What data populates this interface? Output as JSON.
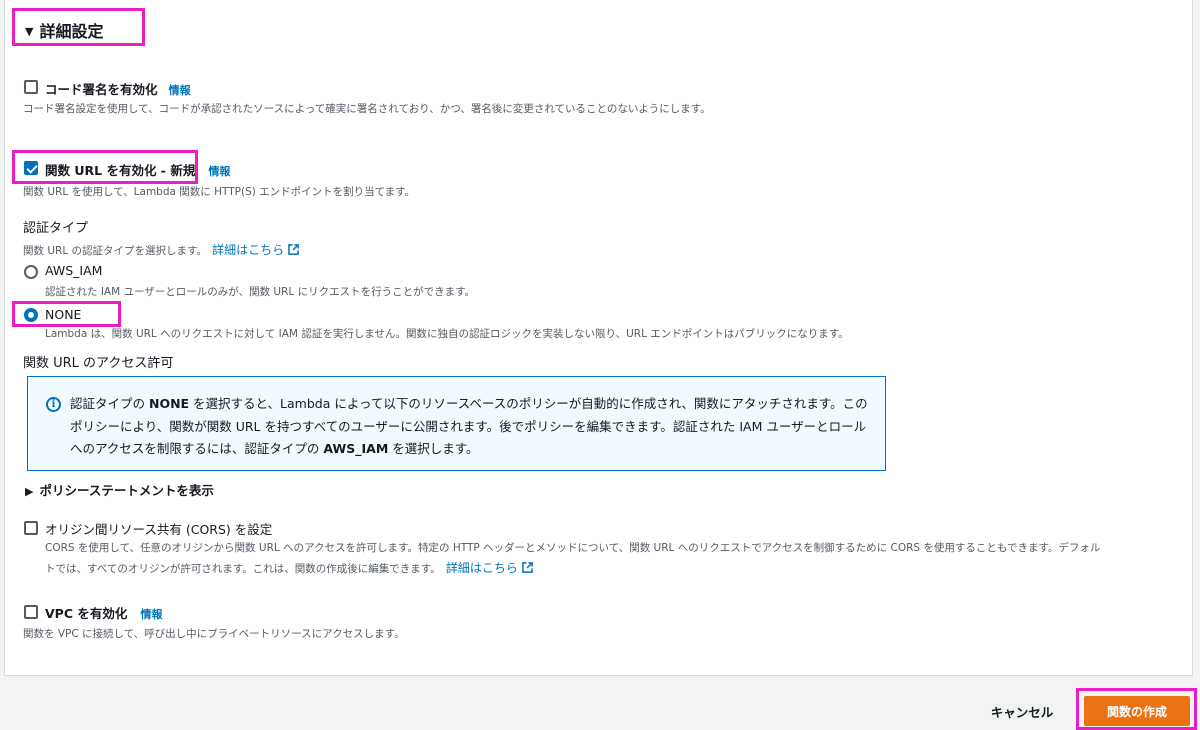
{
  "section": {
    "title": "詳細設定",
    "arrow": "▼"
  },
  "code_signing": {
    "label": "コード署名を有効化",
    "info": "情報",
    "description": "コード署名設定を使用して、コードが承認されたソースによって確実に署名されており、かつ、署名後に変更されていることのないようにします。",
    "checked": false
  },
  "function_url": {
    "label": "関数 URL を有効化 - 新規",
    "info": "情報",
    "description": "関数 URL を使用して、Lambda 関数に HTTP(S) エンドポイントを割り当てます。",
    "checked": true
  },
  "auth_type": {
    "heading": "認証タイプ",
    "description": "関数 URL の認証タイプを選択します。",
    "link": "詳細はこちら",
    "options": [
      {
        "label": "AWS_IAM",
        "description": "認証された IAM ユーザーとロールのみが、関数 URL にリクエストを行うことができます。",
        "selected": false
      },
      {
        "label": "NONE",
        "description": "Lambda は、関数 URL へのリクエストに対して IAM 認証を実行しません。関数に独自の認証ロジックを実装しない限り、URL エンドポイントはパブリックになります。",
        "selected": true
      }
    ]
  },
  "permissions": {
    "heading": "関数 URL のアクセス許可",
    "alert": {
      "t1": "認証タイプの ",
      "b1": "NONE",
      "t2": " を選択すると、Lambda によって以下のリソースベースのポリシーが自動的に作成され、関数にアタッチされます。このポリシーにより、関数が関数 URL を持つすべてのユーザーに公開されます。後でポリシーを編集できます。認証された IAM ユーザーとロールへのアクセスを制限するには、認証タイプの ",
      "b2": "AWS_IAM",
      "t3": " を選択します。"
    },
    "policy_toggle": "ポリシーステートメントを表示",
    "policy_arrow": "▶"
  },
  "cors": {
    "label": "オリジン間リソース共有 (CORS) を設定",
    "description_line1": "CORS を使用して、任意のオリジンから関数 URL へのアクセスを許可します。特定の HTTP ヘッダーとメソッドについて、関数 URL へのリクエストでアクセスを制御するために CORS を使用することもできます。デフォル",
    "description_line2": "トでは、すべてのオリジンが許可されます。これは、関数の作成後に編集できます。",
    "link": "詳細はこちら",
    "checked": false
  },
  "vpc": {
    "label": "VPC を有効化",
    "info": "情報",
    "description": "関数を VPC に接続して、呼び出し中にプライベートリソースにアクセスします。",
    "checked": false
  },
  "footer": {
    "cancel": "キャンセル",
    "create": "関数の作成"
  },
  "colors": {
    "accent": "#0073bb",
    "primary_button": "#ec7211",
    "highlight": "#e91ec4"
  }
}
